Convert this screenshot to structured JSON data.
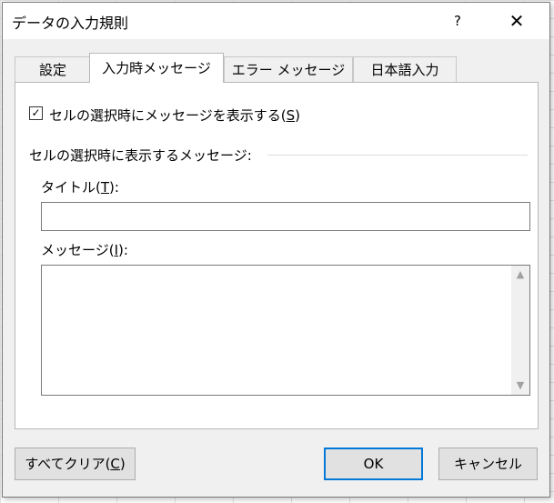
{
  "window": {
    "title": "データの入力規則",
    "help": "?",
    "close": "✕"
  },
  "tabs": [
    {
      "label": "設定",
      "active": false
    },
    {
      "label": "入力時メッセージ",
      "active": true
    },
    {
      "label": "エラー メッセージ",
      "active": false
    },
    {
      "label": "日本語入力",
      "active": false
    }
  ],
  "panel": {
    "show_message_checkbox": {
      "checked": true,
      "label_prefix": "セルの選択時にメッセージを表示する(",
      "mnemonic": "S",
      "label_suffix": ")"
    },
    "group_label": "セルの選択時に表示するメッセージ:",
    "title_field": {
      "label_prefix": "タイトル(",
      "mnemonic": "T",
      "label_suffix": "):",
      "value": ""
    },
    "message_field": {
      "label_prefix": "メッセージ(",
      "mnemonic": "I",
      "label_suffix": "):",
      "value": ""
    }
  },
  "buttons": {
    "clear_all": {
      "label_prefix": "すべてクリア(",
      "mnemonic": "C",
      "label_suffix": ")"
    },
    "ok": "OK",
    "cancel": "キャンセル"
  }
}
